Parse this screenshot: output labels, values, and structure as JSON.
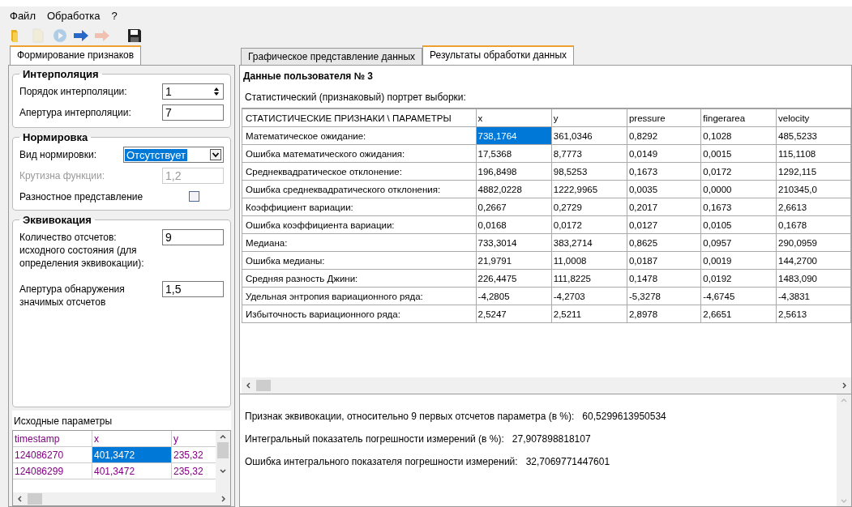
{
  "menu": [
    "Файл",
    "Обработка",
    "?"
  ],
  "toolbar": [
    {
      "kind": "folder",
      "disabled": false
    },
    {
      "kind": "document",
      "disabled": true
    },
    {
      "kind": "play",
      "disabled": true
    },
    {
      "kind": "arrow",
      "disabled": false
    },
    {
      "kind": "arrow",
      "disabled": true
    },
    {
      "kind": "save",
      "disabled": false
    }
  ],
  "left_tabs": [
    {
      "label": "Формирование признаков",
      "selected": true
    }
  ],
  "groups": [
    {
      "title": "Интерполяция",
      "fields": [
        {
          "kind": "spin",
          "label": "Порядок интерполяции:",
          "value": "1",
          "disabled": false
        },
        {
          "kind": "text",
          "label": "Апертура интерполяции:",
          "value": "7",
          "disabled": false
        }
      ]
    },
    {
      "title": "Нормировка",
      "fields": [
        {
          "kind": "combo",
          "label": "Вид нормировки:",
          "value": "Отсутствует",
          "disabled": false
        },
        {
          "kind": "text",
          "label": "Крутизна функции:",
          "value": "1,2",
          "disabled": true
        },
        {
          "kind": "check",
          "label": "Разностное представление",
          "checked": false
        }
      ]
    },
    {
      "title": "Эквивокация",
      "fields": [
        {
          "kind": "text",
          "label": "Количество отсчетов: исходного состояния (для определения эквивокации):",
          "value": "9",
          "disabled": false
        },
        {
          "kind": "text",
          "label": "Апертура обнаружения значимых отсчетов",
          "value": "1,5",
          "disabled": false
        }
      ]
    }
  ],
  "source": {
    "title": "Исходные параметры",
    "columns": [
      "timestamp",
      "x",
      "y"
    ],
    "rows": [
      {
        "cells": [
          {
            "text": "124086270",
            "selected": false
          },
          {
            "text": "401,3472",
            "selected": true
          },
          {
            "text": "235,32",
            "selected": false
          }
        ]
      },
      {
        "cells": [
          {
            "text": "124086299",
            "selected": false
          },
          {
            "text": "401,3472",
            "selected": false
          },
          {
            "text": "235,32",
            "selected": false
          }
        ]
      }
    ]
  },
  "right_tabs": [
    {
      "label": "Графическое представление данных",
      "selected": false
    },
    {
      "label": "Результаты обработки данных",
      "selected": true
    }
  ],
  "user_title": "Данные пользователя №  3",
  "subtitle": "Статистический (признаковый) портрет выборки:",
  "results": {
    "corner": "СТАТИСТИЧЕСКИЕ ПРИЗНАКИ \\ ПАРАМЕТРЫ",
    "columns": [
      "x",
      "y",
      "pressure",
      "fingerarea",
      "velocity"
    ],
    "rows": [
      {
        "label": "Математическое ожидание:",
        "cells": [
          {
            "text": "738,1764",
            "selected": true
          },
          {
            "text": "361,0346",
            "selected": false
          },
          {
            "text": "0,8292",
            "selected": false
          },
          {
            "text": "0,1028",
            "selected": false
          },
          {
            "text": "485,5233",
            "selected": false
          }
        ]
      },
      {
        "label": "Ошибка математического ожидания:",
        "cells": [
          {
            "text": "17,5368",
            "selected": false
          },
          {
            "text": "8,7773",
            "selected": false
          },
          {
            "text": "0,0149",
            "selected": false
          },
          {
            "text": "0,0015",
            "selected": false
          },
          {
            "text": "115,1108",
            "selected": false
          }
        ]
      },
      {
        "label": "Среднеквадратическое отклонение:",
        "cells": [
          {
            "text": "196,8498",
            "selected": false
          },
          {
            "text": "98,5253",
            "selected": false
          },
          {
            "text": "0,1673",
            "selected": false
          },
          {
            "text": "0,0172",
            "selected": false
          },
          {
            "text": "1292,115",
            "selected": false
          }
        ]
      },
      {
        "label": "Ошибка среднеквадратического отклонения:",
        "cells": [
          {
            "text": "4882,0228",
            "selected": false
          },
          {
            "text": "1222,9965",
            "selected": false
          },
          {
            "text": "0,0035",
            "selected": false
          },
          {
            "text": "0,0000",
            "selected": false
          },
          {
            "text": "210345,0",
            "selected": false
          }
        ]
      },
      {
        "label": "Коэффициент вариации:",
        "cells": [
          {
            "text": "0,2667",
            "selected": false
          },
          {
            "text": "0,2729",
            "selected": false
          },
          {
            "text": "0,2017",
            "selected": false
          },
          {
            "text": "0,1673",
            "selected": false
          },
          {
            "text": "2,6613",
            "selected": false
          }
        ]
      },
      {
        "label": "Ошибка коэффициента вариации:",
        "cells": [
          {
            "text": "0,0168",
            "selected": false
          },
          {
            "text": "0,0172",
            "selected": false
          },
          {
            "text": "0,0127",
            "selected": false
          },
          {
            "text": "0,0105",
            "selected": false
          },
          {
            "text": "0,1678",
            "selected": false
          }
        ]
      },
      {
        "label": "Медиана:",
        "cells": [
          {
            "text": "733,3014",
            "selected": false
          },
          {
            "text": "383,2714",
            "selected": false
          },
          {
            "text": "0,8625",
            "selected": false
          },
          {
            "text": "0,0957",
            "selected": false
          },
          {
            "text": "290,0959",
            "selected": false
          }
        ]
      },
      {
        "label": "Ошибка медианы:",
        "cells": [
          {
            "text": "21,9791",
            "selected": false
          },
          {
            "text": "11,0008",
            "selected": false
          },
          {
            "text": "0,0187",
            "selected": false
          },
          {
            "text": "0,0019",
            "selected": false
          },
          {
            "text": "144,2700",
            "selected": false
          }
        ]
      },
      {
        "label": "Средняя разность Джини:",
        "cells": [
          {
            "text": "226,4475",
            "selected": false
          },
          {
            "text": "111,8225",
            "selected": false
          },
          {
            "text": "0,1478",
            "selected": false
          },
          {
            "text": "0,0192",
            "selected": false
          },
          {
            "text": "1483,090",
            "selected": false
          }
        ]
      },
      {
        "label": "Удельная энтропия вариационного ряда:",
        "cells": [
          {
            "text": "-4,2805",
            "selected": false
          },
          {
            "text": "-4,2703",
            "selected": false
          },
          {
            "text": "-5,3278",
            "selected": false
          },
          {
            "text": "-4,6745",
            "selected": false
          },
          {
            "text": "-4,3831",
            "selected": false
          }
        ]
      },
      {
        "label": "Избыточность вариационного ряда:",
        "cells": [
          {
            "text": "2,5247",
            "selected": false
          },
          {
            "text": "2,5211",
            "selected": false
          },
          {
            "text": "2,8978",
            "selected": false
          },
          {
            "text": "2,6651",
            "selected": false
          },
          {
            "text": "2,5613",
            "selected": false
          }
        ]
      }
    ]
  },
  "summary": [
    {
      "label": "Признак эквивокации, относительно 9 первых отсчетов параметра (в %):",
      "value": "60,5299613950534"
    },
    {
      "label": "Интегральный показатель погрешности измерений (в %):",
      "value": "27,907898818107"
    },
    {
      "label": "Ошибка интегрального показателя погрешности измерений:",
      "value": "32,7069771447601"
    }
  ]
}
